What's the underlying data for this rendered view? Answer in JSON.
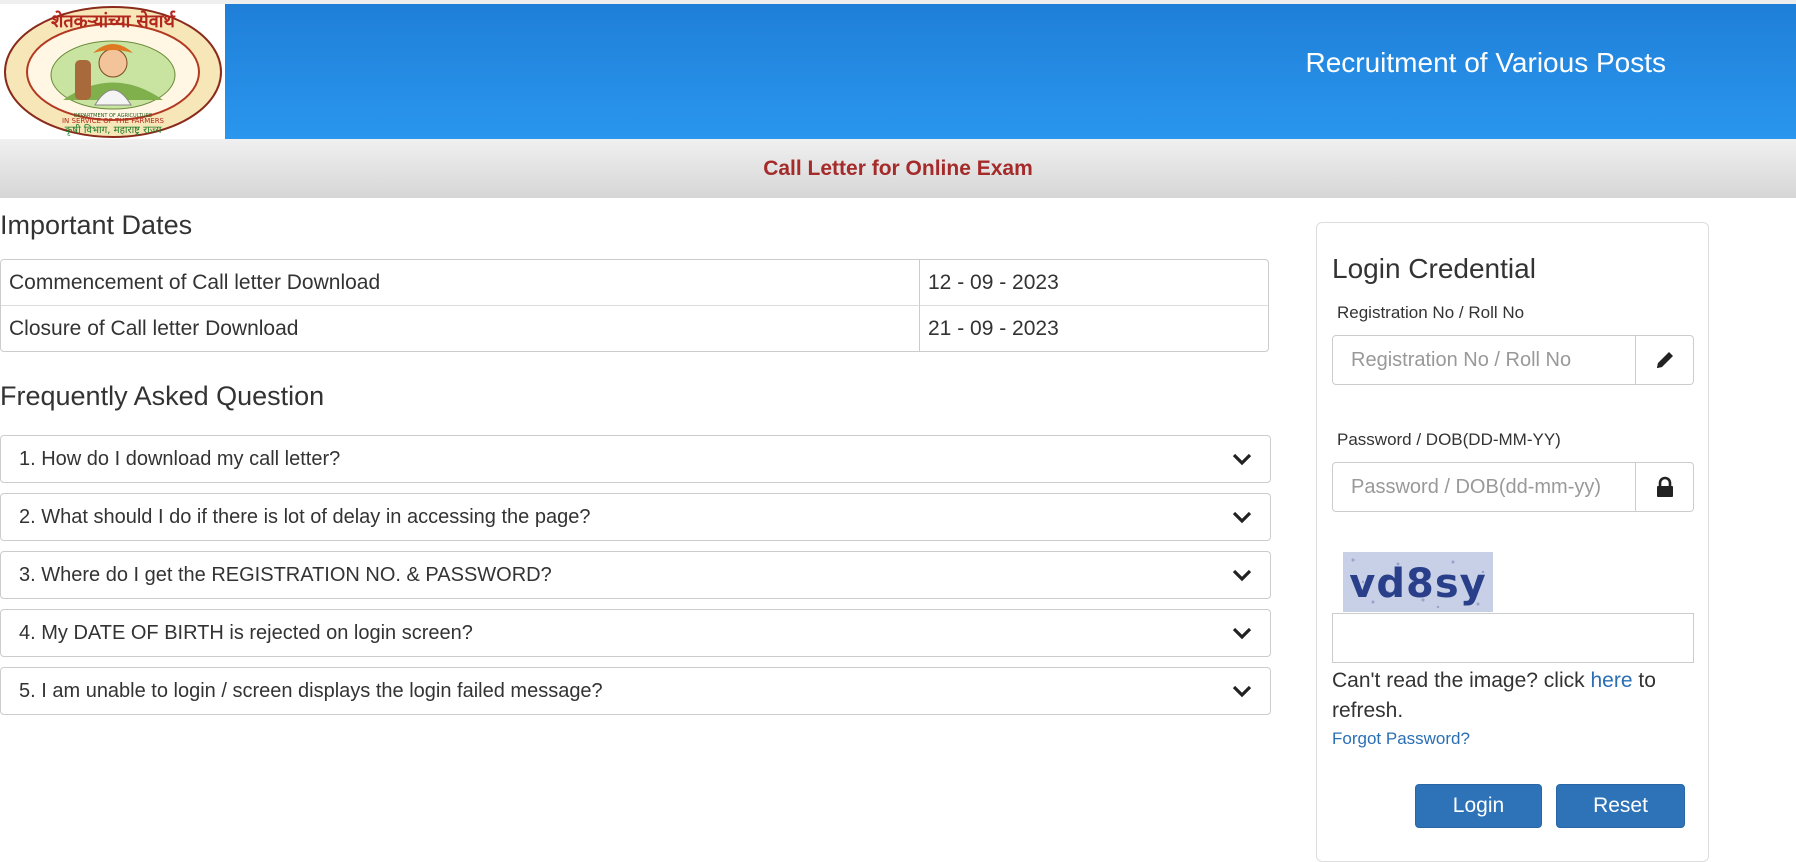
{
  "header": {
    "logo_text_top": "शेतकऱ्यांच्या सेवार्थ",
    "logo_text_inner": "IN SERVICE OF THE FARMERS",
    "logo_text_dept": "DEPARTMENT OF AGRICULTURE",
    "logo_text_bottom": "कृषी विभाग, महाराष्ट्र राज्य",
    "title": "Recruitment of Various Posts"
  },
  "subbar": {
    "title": "Call Letter for Online Exam"
  },
  "important_dates": {
    "title": "Important Dates",
    "rows": [
      {
        "label": "Commencement of Call letter Download",
        "value": "12 - 09 - 2023"
      },
      {
        "label": "Closure of Call letter Download",
        "value": "21 - 09 - 2023"
      }
    ]
  },
  "faq": {
    "title": "Frequently Asked Question",
    "items": [
      {
        "question": "1. How do I download my call letter?"
      },
      {
        "question": "2. What should I do if there is lot of delay in accessing the page?"
      },
      {
        "question": "3. Where do I get the REGISTRATION NO. & PASSWORD?"
      },
      {
        "question": "4. My DATE OF BIRTH is rejected on login screen?"
      },
      {
        "question": "5. I am unable to login / screen displays the login failed message?"
      }
    ]
  },
  "login": {
    "title": "Login Credential",
    "reg_label": "Registration No / Roll No",
    "reg_placeholder": "Registration No / Roll No",
    "reg_value": "",
    "pwd_label": "Password / DOB(DD-MM-YY)",
    "pwd_placeholder": "Password / DOB(dd-mm-yy)",
    "pwd_value": "",
    "captcha_text": "vd8sy",
    "captcha_value": "",
    "refresh_prefix": "Can't read the image? click",
    "refresh_link": "here",
    "refresh_suffix": "to refresh.",
    "forgot": "Forgot Password?",
    "login_button": "Login",
    "reset_button": "Reset"
  },
  "icons": {
    "reg_addon": "pencil-icon",
    "pwd_addon": "lock-icon",
    "faq_toggle": "chevron-down-icon"
  },
  "colors": {
    "banner": "#2a8fe8",
    "subbar_title": "#a52a2a",
    "button": "#2e73b8",
    "link": "#2a6fb5"
  }
}
